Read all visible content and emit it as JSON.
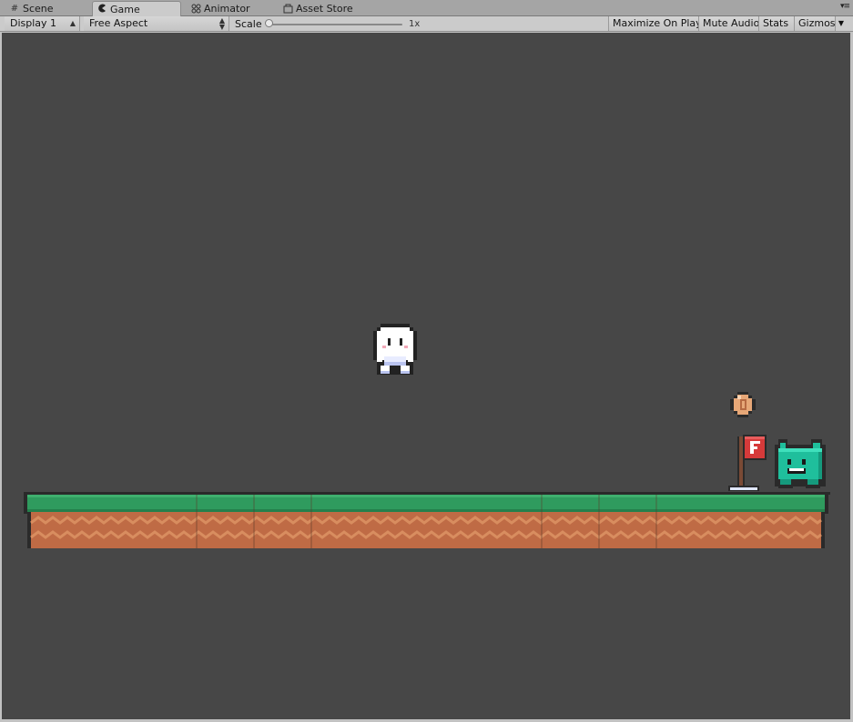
{
  "tabs": [
    {
      "label": "Scene",
      "icon": "grid-icon",
      "active": false
    },
    {
      "label": "Game",
      "icon": "pacman-icon",
      "active": true
    },
    {
      "label": "Animator",
      "icon": "animator-icon",
      "active": false
    },
    {
      "label": "Asset Store",
      "icon": "store-icon",
      "active": false
    }
  ],
  "toolbar": {
    "display": "Display 1",
    "aspect": "Free Aspect",
    "scale_label": "Scale",
    "scale_value": "1x",
    "maximize_on_play": "Maximize On Play",
    "mute_audio": "Mute Audio",
    "stats": "Stats",
    "gizmos": "Gizmos"
  },
  "colors": {
    "game_background": "#474747",
    "grass": "#2f9b5e",
    "dirt": "#bf6b45",
    "enemy": "#1fbf9c",
    "flag": "#d63a3a"
  },
  "scene": {
    "flag_letter": "F"
  }
}
